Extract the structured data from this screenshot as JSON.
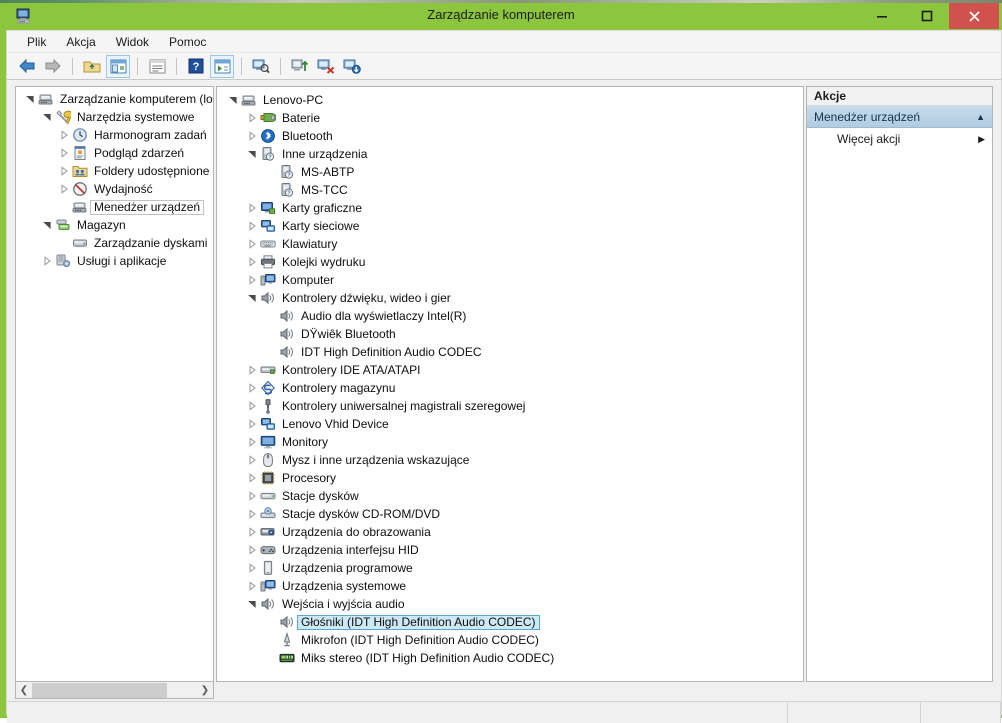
{
  "window": {
    "title": "Zarządzanie komputerem",
    "icon": "computer-management-icon",
    "accent_color": "#8cc63e",
    "close_color": "#d1514f",
    "minimize_label": "Minimalizuj",
    "maximize_label": "Maksymalizuj",
    "close_label": "Zamknij"
  },
  "menu": {
    "items": [
      {
        "label": "Plik",
        "name": "menu-plik"
      },
      {
        "label": "Akcja",
        "name": "menu-akcja"
      },
      {
        "label": "Widok",
        "name": "menu-widok"
      },
      {
        "label": "Pomoc",
        "name": "menu-pomoc"
      }
    ]
  },
  "toolbar": {
    "buttons": [
      {
        "name": "back-arrow-icon",
        "glyph": "←",
        "color": "#2a6fb0",
        "framed": false
      },
      {
        "name": "forward-arrow-icon",
        "glyph": "→",
        "color": "#9a9a9a",
        "framed": false
      },
      {
        "name": "up-folder-icon",
        "glyph": "",
        "color": "#d8b04a",
        "framed": false
      },
      {
        "name": "show-console-tree-icon",
        "glyph": "",
        "color": "#3c7fbf",
        "framed": true
      },
      {
        "name": "properties-icon",
        "glyph": "",
        "color": "#7a7a7a",
        "framed": false
      },
      {
        "name": "help-icon",
        "glyph": "?",
        "color": "#1f4e9c",
        "framed": false
      },
      {
        "name": "show-action-pane-icon",
        "glyph": "",
        "color": "#3c7fbf",
        "framed": true
      },
      {
        "name": "scan-hardware-changes-icon",
        "glyph": "",
        "color": "#4a6f9c",
        "framed": false
      },
      {
        "name": "update-driver-icon",
        "glyph": "",
        "color": "#3e8f3e",
        "framed": false
      },
      {
        "name": "uninstall-device-icon",
        "glyph": "",
        "color": "#c0392b",
        "framed": false
      },
      {
        "name": "disable-device-icon",
        "glyph": "",
        "color": "#2a6fb0",
        "framed": false
      }
    ]
  },
  "left_tree": {
    "items": [
      {
        "label": "Zarządzanie komputerem (loka",
        "indent": 0,
        "state": "expanded",
        "icon": "computer-management-icon",
        "selected": false
      },
      {
        "label": "Narzędzia systemowe",
        "indent": 1,
        "state": "expanded",
        "icon": "tools-icon",
        "selected": false
      },
      {
        "label": "Harmonogram zadań",
        "indent": 2,
        "state": "collapsed",
        "icon": "clock-icon",
        "selected": false
      },
      {
        "label": "Podgląd zdarzeń",
        "indent": 2,
        "state": "collapsed",
        "icon": "event-viewer-icon",
        "selected": false
      },
      {
        "label": "Foldery udostępnione",
        "indent": 2,
        "state": "collapsed",
        "icon": "shared-folders-icon",
        "selected": false
      },
      {
        "label": "Wydajność",
        "indent": 2,
        "state": "collapsed",
        "icon": "performance-icon",
        "selected": false
      },
      {
        "label": "Menedżer urządzeń",
        "indent": 2,
        "state": "leaf",
        "icon": "device-manager-icon",
        "selected": true
      },
      {
        "label": "Magazyn",
        "indent": 1,
        "state": "expanded",
        "icon": "storage-icon",
        "selected": false
      },
      {
        "label": "Zarządzanie dyskami",
        "indent": 2,
        "state": "leaf",
        "icon": "disk-management-icon",
        "selected": false
      },
      {
        "label": "Usługi i aplikacje",
        "indent": 1,
        "state": "collapsed",
        "icon": "services-icon",
        "selected": false
      }
    ]
  },
  "device_tree": {
    "items": [
      {
        "label": "Lenovo-PC",
        "indent": 0,
        "state": "expanded",
        "icon": "computer-icon",
        "selected": false
      },
      {
        "label": "Baterie",
        "indent": 1,
        "state": "collapsed",
        "icon": "battery-icon",
        "selected": false
      },
      {
        "label": "Bluetooth",
        "indent": 1,
        "state": "collapsed",
        "icon": "bluetooth-icon",
        "selected": false
      },
      {
        "label": "Inne urządzenia",
        "indent": 1,
        "state": "expanded",
        "icon": "unknown-device-icon",
        "selected": false
      },
      {
        "label": "MS-ABTP",
        "indent": 2,
        "state": "leaf",
        "icon": "unknown-device-icon",
        "selected": false
      },
      {
        "label": "MS-TCC",
        "indent": 2,
        "state": "leaf",
        "icon": "unknown-device-icon",
        "selected": false
      },
      {
        "label": "Karty graficzne",
        "indent": 1,
        "state": "collapsed",
        "icon": "display-adapter-icon",
        "selected": false
      },
      {
        "label": "Karty sieciowe",
        "indent": 1,
        "state": "collapsed",
        "icon": "network-adapter-icon",
        "selected": false
      },
      {
        "label": "Klawiatury",
        "indent": 1,
        "state": "collapsed",
        "icon": "keyboard-icon",
        "selected": false
      },
      {
        "label": "Kolejki wydruku",
        "indent": 1,
        "state": "collapsed",
        "icon": "printer-icon",
        "selected": false
      },
      {
        "label": "Komputer",
        "indent": 1,
        "state": "collapsed",
        "icon": "computer-node-icon",
        "selected": false
      },
      {
        "label": "Kontrolery dźwięku, wideo i gier",
        "indent": 1,
        "state": "expanded",
        "icon": "speaker-icon",
        "selected": false
      },
      {
        "label": "Audio dla wyświetlaczy Intel(R)",
        "indent": 2,
        "state": "leaf",
        "icon": "speaker-icon",
        "selected": false
      },
      {
        "label": "DŸwiêk Bluetooth",
        "indent": 2,
        "state": "leaf",
        "icon": "speaker-icon",
        "selected": false
      },
      {
        "label": "IDT High Definition Audio CODEC",
        "indent": 2,
        "state": "leaf",
        "icon": "speaker-icon",
        "selected": false
      },
      {
        "label": "Kontrolery IDE ATA/ATAPI",
        "indent": 1,
        "state": "collapsed",
        "icon": "ide-controller-icon",
        "selected": false
      },
      {
        "label": "Kontrolery magazynu",
        "indent": 1,
        "state": "collapsed",
        "icon": "storage-controller-icon",
        "selected": false
      },
      {
        "label": "Kontrolery uniwersalnej magistrali szeregowej",
        "indent": 1,
        "state": "collapsed",
        "icon": "usb-icon",
        "selected": false
      },
      {
        "label": "Lenovo Vhid Device",
        "indent": 1,
        "state": "collapsed",
        "icon": "network-adapter-icon",
        "selected": false
      },
      {
        "label": "Monitory",
        "indent": 1,
        "state": "collapsed",
        "icon": "monitor-icon",
        "selected": false
      },
      {
        "label": "Mysz i inne urządzenia wskazujące",
        "indent": 1,
        "state": "collapsed",
        "icon": "mouse-icon",
        "selected": false
      },
      {
        "label": "Procesory",
        "indent": 1,
        "state": "collapsed",
        "icon": "processor-icon",
        "selected": false
      },
      {
        "label": "Stacje dysków",
        "indent": 1,
        "state": "collapsed",
        "icon": "disk-drive-icon",
        "selected": false
      },
      {
        "label": "Stacje dysków CD-ROM/DVD",
        "indent": 1,
        "state": "collapsed",
        "icon": "cdrom-icon",
        "selected": false
      },
      {
        "label": "Urządzenia do obrazowania",
        "indent": 1,
        "state": "collapsed",
        "icon": "imaging-device-icon",
        "selected": false
      },
      {
        "label": "Urządzenia interfejsu HID",
        "indent": 1,
        "state": "collapsed",
        "icon": "hid-icon",
        "selected": false
      },
      {
        "label": "Urządzenia programowe",
        "indent": 1,
        "state": "collapsed",
        "icon": "software-device-icon",
        "selected": false
      },
      {
        "label": "Urządzenia systemowe",
        "indent": 1,
        "state": "collapsed",
        "icon": "system-device-icon",
        "selected": false
      },
      {
        "label": "Wejścia i wyjścia audio",
        "indent": 1,
        "state": "expanded",
        "icon": "speaker-icon",
        "selected": false
      },
      {
        "label": "Głośniki (IDT High Definition Audio CODEC)",
        "indent": 2,
        "state": "leaf",
        "icon": "speaker-icon",
        "selected": true
      },
      {
        "label": "Mikrofon (IDT High Definition Audio CODEC)",
        "indent": 2,
        "state": "leaf",
        "icon": "microphone-icon",
        "selected": false
      },
      {
        "label": "Miks stereo (IDT High Definition Audio CODEC)",
        "indent": 2,
        "state": "leaf",
        "icon": "stereo-mix-icon",
        "selected": false
      }
    ]
  },
  "actions": {
    "header": "Akcje",
    "group_label": "Menedżer urządzeń",
    "group_collapse_glyph": "▲",
    "items": [
      {
        "label": "Więcej akcji",
        "glyph": "▶",
        "name": "action-more-actions"
      }
    ]
  },
  "scrollbar": {
    "left_glyph": "❮",
    "right_glyph": "❯"
  },
  "statusbar": {
    "left": "",
    "middle": "",
    "right": ""
  }
}
